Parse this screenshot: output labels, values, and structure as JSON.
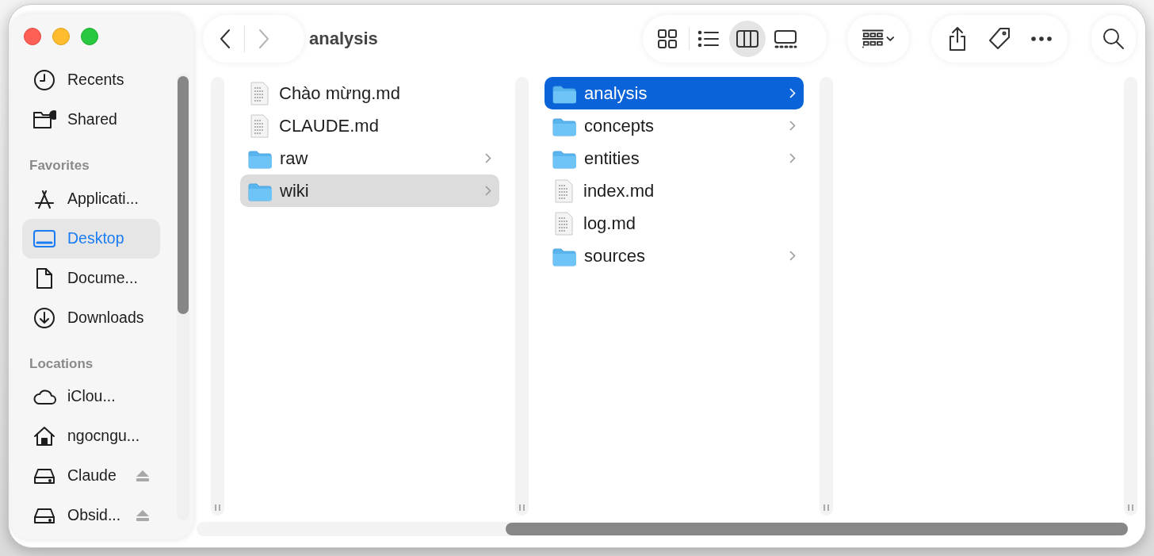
{
  "window": {
    "title": "analysis"
  },
  "navigation": {
    "back_disabled": false,
    "forward_disabled": true
  },
  "sidebar": {
    "sections": [
      {
        "items": [
          {
            "label": "Recents",
            "kind": "clock",
            "selected": false,
            "eject": false
          },
          {
            "label": "Shared",
            "kind": "shared",
            "selected": false,
            "eject": false
          }
        ]
      },
      {
        "heading": "Favorites",
        "items": [
          {
            "label": "Applicati...",
            "kind": "apps",
            "selected": false,
            "eject": false
          },
          {
            "label": "Desktop",
            "kind": "desktop",
            "selected": true,
            "eject": false
          },
          {
            "label": "Docume...",
            "kind": "document",
            "selected": false,
            "eject": false
          },
          {
            "label": "Downloads",
            "kind": "download",
            "selected": false,
            "eject": false
          }
        ]
      },
      {
        "heading": "Locations",
        "items": [
          {
            "label": "iClou...",
            "kind": "cloud",
            "selected": false,
            "eject": false
          },
          {
            "label": "ngocngu...",
            "kind": "home",
            "selected": false,
            "eject": false
          },
          {
            "label": "Claude",
            "kind": "drive",
            "selected": false,
            "eject": true
          },
          {
            "label": "Obsid...",
            "kind": "drive",
            "selected": false,
            "eject": true
          }
        ]
      }
    ]
  },
  "view_modes": [
    {
      "kind": "icons",
      "selected": false
    },
    {
      "kind": "list",
      "selected": false
    },
    {
      "kind": "columns",
      "selected": true
    },
    {
      "kind": "gallery",
      "selected": false
    }
  ],
  "columns": [
    {
      "items": [
        {
          "name": "Chào mừng.md",
          "kind": "file",
          "selected": false
        },
        {
          "name": "CLAUDE.md",
          "kind": "file",
          "selected": false
        },
        {
          "name": "raw",
          "kind": "folder",
          "selected": false
        },
        {
          "name": "wiki",
          "kind": "folder",
          "selected": true
        }
      ]
    },
    {
      "items": [
        {
          "name": "analysis",
          "kind": "folder",
          "selected": true
        },
        {
          "name": "concepts",
          "kind": "folder",
          "selected": false
        },
        {
          "name": "entities",
          "kind": "folder",
          "selected": false
        },
        {
          "name": "index.md",
          "kind": "file",
          "selected": false
        },
        {
          "name": "log.md",
          "kind": "file",
          "selected": false
        },
        {
          "name": "sources",
          "kind": "folder",
          "selected": false
        }
      ]
    },
    {}
  ]
}
